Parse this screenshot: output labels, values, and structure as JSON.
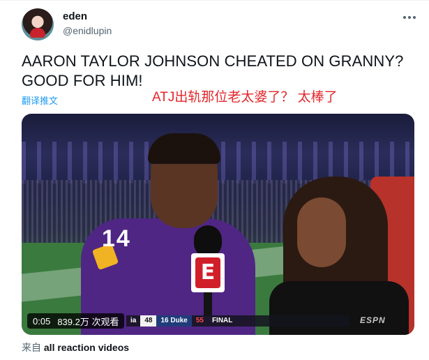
{
  "author": {
    "display_name": "eden",
    "handle": "@enidlupin"
  },
  "tweet": {
    "text": "AARON TAYLOR JOHNSON CHEATED ON GRANNY? GOOD FOR HIM!",
    "translate_label": "翻译推文",
    "annotation": "ATJ出轨那位老太婆了？ 太棒了",
    "annotation_color": "#e3262b"
  },
  "video": {
    "elapsed": "0:05",
    "views": "839.2万 次观看",
    "jersey_number": "14",
    "mic_flag_letter": "E",
    "scorebug": {
      "team_a_fragment": "ia",
      "team_a_score": "48",
      "team_b": "16 Duke",
      "team_b_score": "55",
      "status": "FINAL"
    },
    "network_logo": "ESPN"
  },
  "source": {
    "prefix": "来自",
    "name": "all reaction videos"
  },
  "colors": {
    "link_blue": "#1d9bf0",
    "text_primary": "#0f1419",
    "text_secondary": "#536471"
  }
}
